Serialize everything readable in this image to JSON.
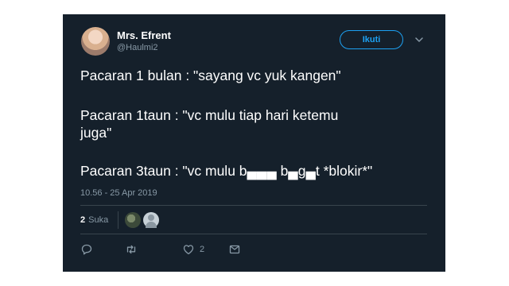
{
  "user": {
    "display_name": "Mrs. Efrent",
    "handle": "@Haulmi2"
  },
  "header": {
    "follow_label": "Ikuti"
  },
  "tweet": {
    "lines": [
      "Pacaran 1 bulan : \"sayang vc yuk kangen\"",
      "Pacaran 1taun : \"vc mulu tiap hari ketemu",
      "juga\"",
      "Pacaran 3taun : \"vc mulu b▄▄▄ b▄g▄t *blokir*\""
    ],
    "timestamp": "10.56 - 25 Apr 2019"
  },
  "stats": {
    "likes_count": "2",
    "likes_label": "Suka"
  },
  "actions": {
    "like_count": "2"
  },
  "colors": {
    "background": "#15202b",
    "accent": "#1da1f2",
    "muted_text": "#8899a6"
  }
}
